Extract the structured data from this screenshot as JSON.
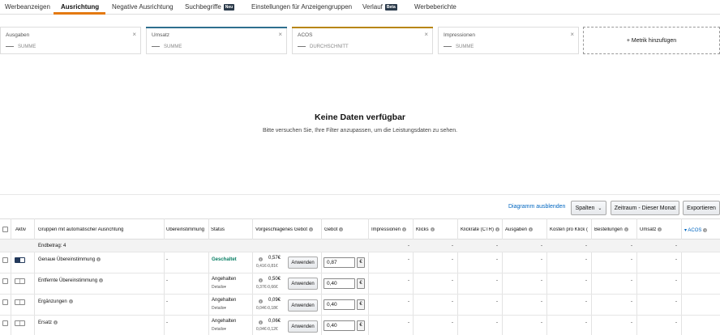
{
  "tabs": [
    {
      "label": "Werbeanzeigen",
      "active": false
    },
    {
      "label": "Ausrichtung",
      "active": true
    },
    {
      "label": "Negative Ausrichtung",
      "active": false
    },
    {
      "label": "Suchbegriffe",
      "active": false,
      "badge": "Neu"
    },
    {
      "label": "Einstellungen für Anzeigengruppen",
      "active": false
    },
    {
      "label": "Verlauf",
      "active": false,
      "badge": "Beta"
    },
    {
      "label": "Werbeberichte",
      "active": false
    }
  ],
  "metrics": [
    {
      "name": "Ausgaben",
      "sub": "SUMME",
      "color": ""
    },
    {
      "name": "Umsatz",
      "sub": "SUMME",
      "color": "#2e6f8e"
    },
    {
      "name": "ACOS",
      "sub": "DURCHSCHNITT",
      "color": "#b8860b"
    },
    {
      "name": "Impressionen",
      "sub": "SUMME",
      "color": ""
    }
  ],
  "add_metric_label": "+ Metrik hinzufügen",
  "empty_state": {
    "title": "Keine Daten verfügbar",
    "subtitle": "Bitte versuchen Sie, Ihre Filter anzupassen, um die Leistungsdaten zu sehen."
  },
  "toolbar": {
    "hide_chart": "Diagramm ausblenden",
    "columns": "Spalten",
    "date_range": "Zeitraum - Dieser Monat",
    "export": "Exportieren"
  },
  "table": {
    "headers": {
      "active": "Aktiv",
      "group": "Gruppen mit automatischer Ausrichtung",
      "match": "Übereinstimmung",
      "status": "Status",
      "suggested": "Vorgeschlagenes Gebot",
      "bid": "Gebot",
      "impressions": "Impressionen",
      "clicks": "Klicks",
      "ctr": "Klickrate (CTR)",
      "spend": "Ausgaben",
      "cpc": "Kosten pro Klick (",
      "orders": "Bestellungen",
      "sales": "Umsatz",
      "acos": "ACOS"
    },
    "summary_label": "Endbetrag: 4",
    "dash": "-",
    "apply_label": "Anwenden",
    "currency": "€",
    "details_label": "Details",
    "rows": [
      {
        "name": "Genaue Übereinstimmung",
        "active": true,
        "match": "-",
        "status": "Geschaltet",
        "status_paused": false,
        "suggested": "0,57€",
        "range": "0,41€-0,81€",
        "bid": "0,87"
      },
      {
        "name": "Entfernte Übereinstimmung",
        "active": false,
        "match": "-",
        "status": "Angehalten",
        "status_paused": true,
        "suggested": "0,50€",
        "range": "0,37€-0,66€",
        "bid": "0,40"
      },
      {
        "name": "Ergänzungen",
        "active": false,
        "match": "-",
        "status": "Angehalten",
        "status_paused": true,
        "suggested": "0,09€",
        "range": "0,04€-0,18€",
        "bid": "0,40"
      },
      {
        "name": "Ersatz",
        "active": false,
        "match": "-",
        "status": "Angehalten",
        "status_paused": true,
        "suggested": "0,06€",
        "range": "0,04€-0,12€",
        "bid": "0,40"
      }
    ]
  }
}
